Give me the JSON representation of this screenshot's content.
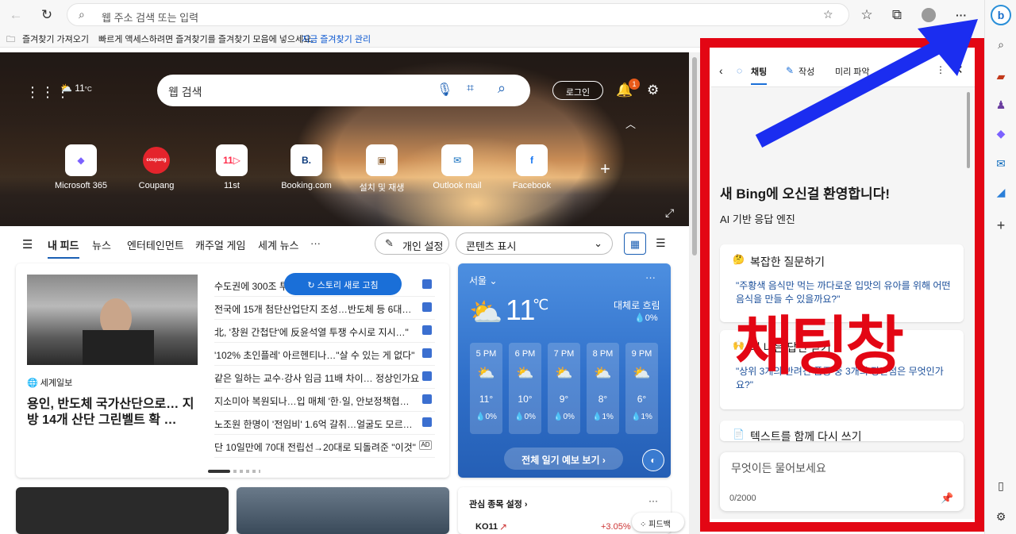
{
  "browser": {
    "address_placeholder": "웹 주소 검색 또는 입력",
    "favbar": {
      "import": "즐겨찾기 가져오기",
      "hint": "빠르게 액세스하려면 즐겨찾기를 즐겨찾기 모음에 넣으세요.",
      "manage": "지금 즐겨찾기 관리"
    },
    "more": "···"
  },
  "hero": {
    "weather_temp": "11",
    "weather_unit": "°C",
    "search_placeholder": "웹 검색",
    "login": "로그인",
    "notif_count": "1",
    "quick_links": [
      {
        "label": "Microsoft 365",
        "tile": "◆",
        "color": "#7b61ff"
      },
      {
        "label": "Coupang",
        "tile": "coupang",
        "color": "#e4242c"
      },
      {
        "label": "11st",
        "tile": "11▷",
        "color": "#ff2b4a"
      },
      {
        "label": "Booking.com",
        "tile": "B.",
        "color": "#0c3b7c"
      },
      {
        "label": "설치 및 재생",
        "tile": "▣",
        "color": "#8a5a2a"
      },
      {
        "label": "Outlook mail",
        "tile": "✉",
        "color": "#0f6cbd"
      },
      {
        "label": "Facebook",
        "tile": "f",
        "color": "#1877f2"
      }
    ]
  },
  "feednav": {
    "tabs": [
      "내 피드",
      "뉴스",
      "엔터테인먼트",
      "캐주얼 게임",
      "세계 뉴스",
      "···"
    ],
    "personalize": "개인 설정",
    "content_select": "콘텐츠 표시"
  },
  "news": {
    "refresh": "스토리 새로 고침",
    "source": "세계일보",
    "headline": "용인, 반도체 국가산단으로… 지방 14개 산단 그린벨트 확 …",
    "items": [
      "수도권에 300조 투",
      "전국에 15개 첨단산업단지 조성…반도체 등 6대…",
      "北, '창원 간첩단'에 反윤석열 투쟁 수시로 지시…\"",
      "'102% 초인플레' 아르헨티나…\"살 수 있는 게 없다\"",
      "같은 일하는 교수·강사 임금 11배 차이… 정상인가요",
      "지소미아 복원되나…입 매체 '한·일, 안보정책협…",
      "노조원 한명이 '전임비' 1.6억 갈취…얼굴도 모르…",
      "단 10일만에 70대 전립선→20대로 되돌려준 \"이것\""
    ],
    "ad": "AD"
  },
  "weather": {
    "city": "서울",
    "temp": "11",
    "unit": "℃",
    "cond": "대체로 흐림",
    "precip": "0%",
    "hours": [
      {
        "t": "5 PM",
        "temp": "11°",
        "p": "0%"
      },
      {
        "t": "6 PM",
        "temp": "10°",
        "p": "0%"
      },
      {
        "t": "7 PM",
        "temp": "9°",
        "p": "0%"
      },
      {
        "t": "8 PM",
        "temp": "8°",
        "p": "1%"
      },
      {
        "t": "9 PM",
        "temp": "6°",
        "p": "1%"
      }
    ],
    "forecast_btn": "전체 일기 예보 보기"
  },
  "stocks": {
    "title": "관심 종목 설정",
    "ticker": "KO11",
    "change": "+3.05%",
    "feedback": "피드백"
  },
  "chat": {
    "tabs": [
      "채팅",
      "작성",
      "미리 파악"
    ],
    "welcome": "새 Bing에 오신걸 환영합니다!",
    "subtitle": "AI 기반 응답 엔진",
    "card1_title": "복잡한 질문하기",
    "card1_body": "\"주황색 음식만 먹는 까다로운 입맛의 유아를 위해 어떤 음식을 만들 수 있을까요?\"",
    "card2_title": "더 나은 답변 받기",
    "card2_body": "\"상위 3개의 반려견 품종 중 3개의 장단점은 무엇인가요?\"",
    "card3_title": "텍스트를 함께 다시 쓰기",
    "input_placeholder": "무엇이든 물어보세요",
    "counter": "0/2000",
    "overlay_text": "채팅창"
  }
}
